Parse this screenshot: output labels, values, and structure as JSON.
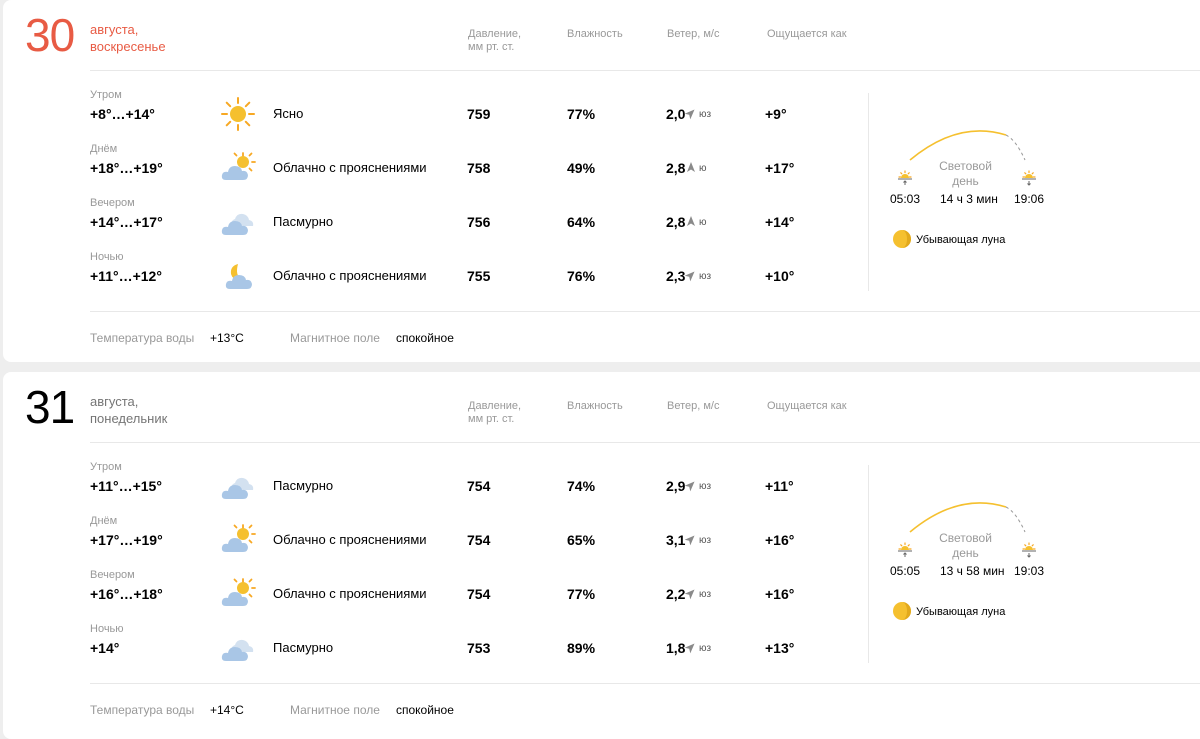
{
  "days": [
    {
      "day": "30",
      "date_text": [
        "августа,",
        "воскресенье"
      ],
      "headers": {
        "pressure": [
          "Давление,",
          "мм рт. ст."
        ],
        "humidity": "Влажность",
        "wind": "Ветер, м/с",
        "feels": "Ощущается как"
      },
      "rows": [
        {
          "part": "Утром",
          "temp": "+8°…+14°",
          "icon": "sun-icon",
          "condition": "Ясно",
          "pressure": "759",
          "humidity": "77%",
          "wind": "2,0",
          "wind_dir": "юз",
          "feels": "+9°"
        },
        {
          "part": "Днём",
          "temp": "+18°…+19°",
          "icon": "partly-cloudy-sun-icon",
          "condition": "Облачно с прояснениями",
          "pressure": "758",
          "humidity": "49%",
          "wind": "2,8",
          "wind_dir": "ю",
          "feels": "+17°"
        },
        {
          "part": "Вечером",
          "temp": "+14°…+17°",
          "icon": "overcast-cloud-icon",
          "condition": "Пасмурно",
          "pressure": "756",
          "humidity": "64%",
          "wind": "2,8",
          "wind_dir": "ю",
          "feels": "+14°"
        },
        {
          "part": "Ночью",
          "temp": "+11°…+12°",
          "icon": "partly-cloudy-moon-icon",
          "condition": "Облачно с прояснениями",
          "pressure": "755",
          "humidity": "76%",
          "wind": "2,3",
          "wind_dir": "юз",
          "feels": "+10°"
        }
      ],
      "sun": {
        "daylight_label": [
          "Световой",
          "день"
        ],
        "sunrise": "05:03",
        "day_length": "14 ч 3 мин",
        "sunset": "19:06"
      },
      "moon": "Убывающая луна",
      "footer": {
        "water_label": "Температура воды",
        "water": "+13°C",
        "magnetic_label": "Магнитное поле",
        "magnetic": "спокойное"
      }
    },
    {
      "day": "31",
      "date_text": [
        "августа,",
        "понедельник"
      ],
      "headers": {
        "pressure": [
          "Давление,",
          "мм рт. ст."
        ],
        "humidity": "Влажность",
        "wind": "Ветер, м/с",
        "feels": "Ощущается как"
      },
      "rows": [
        {
          "part": "Утром",
          "temp": "+11°…+15°",
          "icon": "overcast-cloud-icon",
          "condition": "Пасмурно",
          "pressure": "754",
          "humidity": "74%",
          "wind": "2,9",
          "wind_dir": "юз",
          "feels": "+11°"
        },
        {
          "part": "Днём",
          "temp": "+17°…+19°",
          "icon": "partly-cloudy-sun-icon",
          "condition": "Облачно с прояснениями",
          "pressure": "754",
          "humidity": "65%",
          "wind": "3,1",
          "wind_dir": "юз",
          "feels": "+16°"
        },
        {
          "part": "Вечером",
          "temp": "+16°…+18°",
          "icon": "partly-cloudy-sun-icon",
          "condition": "Облачно с прояснениями",
          "pressure": "754",
          "humidity": "77%",
          "wind": "2,2",
          "wind_dir": "юз",
          "feels": "+16°"
        },
        {
          "part": "Ночью",
          "temp": "+14°",
          "icon": "overcast-cloud-icon",
          "condition": "Пасмурно",
          "pressure": "753",
          "humidity": "89%",
          "wind": "1,8",
          "wind_dir": "юз",
          "feels": "+13°"
        }
      ],
      "sun": {
        "daylight_label": [
          "Световой",
          "день"
        ],
        "sunrise": "05:05",
        "day_length": "13 ч 58 мин",
        "sunset": "19:03"
      },
      "moon": "Убывающая луна",
      "footer": {
        "water_label": "Температура воды",
        "water": "+14°C",
        "magnetic_label": "Магнитное поле",
        "magnetic": "спокойное"
      }
    }
  ],
  "colors": {
    "accent_red": "#e85b44",
    "sun": "#f5c02f",
    "cloud": "#a9c6e6",
    "muted": "#999999"
  }
}
